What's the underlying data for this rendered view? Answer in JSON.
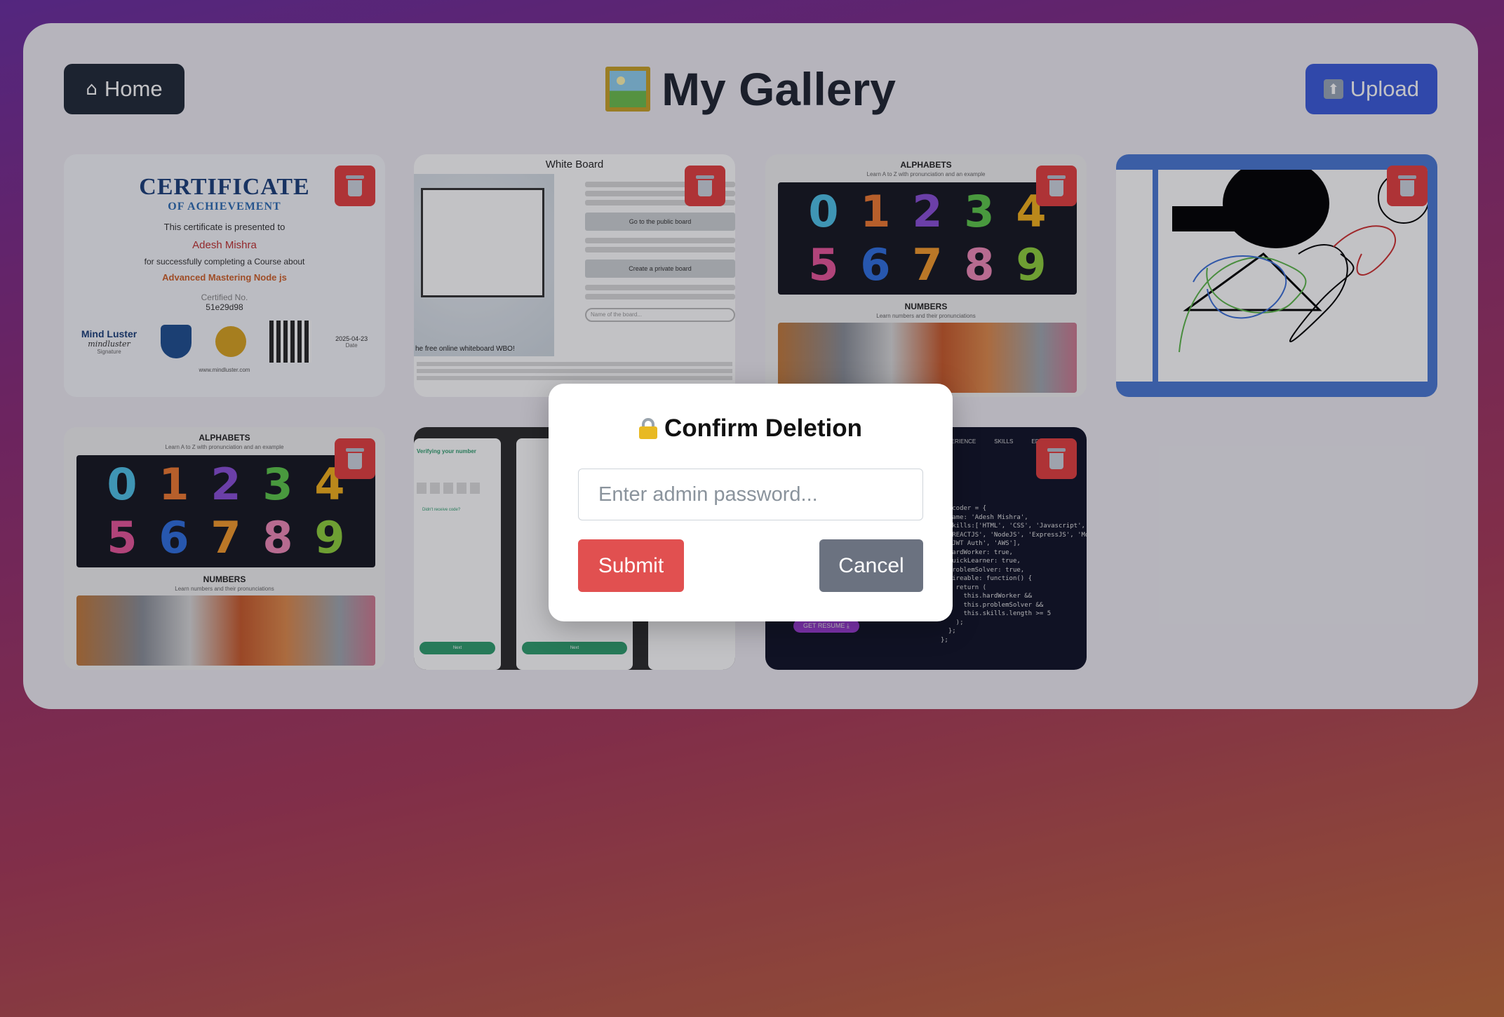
{
  "header": {
    "home_label": "Home",
    "home_icon": "house-icon",
    "title": "My Gallery",
    "title_icon": "framed-picture-icon",
    "upload_label": "Upload",
    "upload_icon": "up-arrow-icon"
  },
  "gallery": {
    "cards": [
      {
        "kind": "certificate",
        "heading": "CERTIFICATE",
        "subheading": "OF ACHIEVEMENT",
        "presented": "This certificate is presented to",
        "name": "Adesh Mishra",
        "completing": "for successfully completing a Course about",
        "course": "Advanced Mastering Node js",
        "cert_no_label": "Certified No.",
        "cert_no": "51e29d98",
        "brand": "Mind Luster",
        "signature": "mindluster",
        "signature_label": "Signature",
        "date": "2025-04-23",
        "date_label": "Date",
        "url": "www.mindluster.com"
      },
      {
        "kind": "whiteboard",
        "heading": "White Board",
        "btn1": "Go to the public board",
        "btn2": "Create a private board",
        "input_placeholder": "Name of the board...",
        "footer": "he free online whiteboard WBO!"
      },
      {
        "kind": "numbers",
        "heading": "ALPHABETS",
        "sub": "Learn A to Z with pronunciation and an example",
        "section": "NUMBERS",
        "section_sub": "Learn numbers and their pronunciations"
      },
      {
        "kind": "drawing"
      },
      {
        "kind": "numbers",
        "heading": "ALPHABETS",
        "sub": "Learn A to Z with pronunciation and an example",
        "section": "NUMBERS",
        "section_sub": "Learn numbers and their pronunciations"
      },
      {
        "kind": "phones",
        "heading1": "Verifying your number",
        "link": "Didn't receive code?",
        "next1": "Next",
        "next2": "Next"
      },
      {
        "kind": "code",
        "nav": [
          "XPERIENCE",
          "SKILLS",
          "EDU"
        ],
        "resume": "GET RESUME ⤓",
        "code": "st coder = {\n  name: 'Adesh Mishra',\n  skills:['HTML', 'CSS', 'Javascript',\n  'REACTJS', 'NodeJS', 'ExpressJS', 'Mo\n  'JWT Auth', 'AWS'],\n  hardWorker: true,\n  quickLearner: true,\n  problemSolver: true,\n  hireable: function() {\n    return (\n      this.hardWorker &&\n      this.problemSolver &&\n      this.skills.length >= 5\n    );\n  };\n};"
      }
    ],
    "delete_icon": "trash-icon"
  },
  "modal": {
    "title": "Confirm Deletion",
    "title_icon": "lock-with-key-icon",
    "password_placeholder": "Enter admin password...",
    "password_value": "",
    "submit_label": "Submit",
    "cancel_label": "Cancel"
  },
  "colors": {
    "home_bg": "#1f2937",
    "upload_bg": "#3b5bdb",
    "delete_bg": "#e53e3e",
    "submit_bg": "#e15050",
    "cancel_bg": "#6b7280"
  }
}
